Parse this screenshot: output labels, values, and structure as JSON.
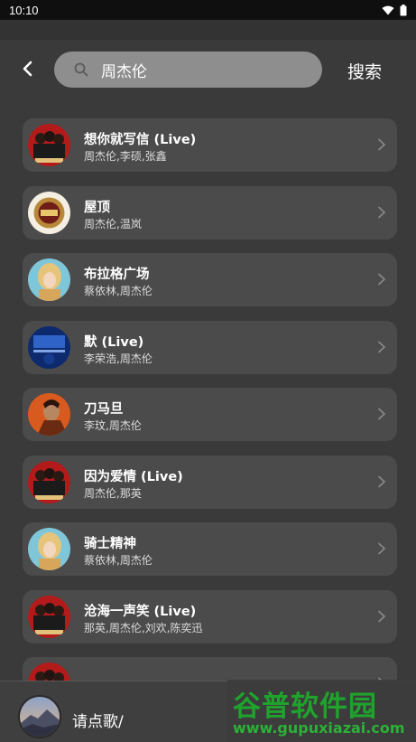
{
  "status_bar": {
    "time": "10:10"
  },
  "search": {
    "query": "周杰伦",
    "button_label": "搜索"
  },
  "songs": [
    {
      "title": "想你就写信 (Live)",
      "artists": "周杰伦,李硕,张鑫",
      "cover": "red-group"
    },
    {
      "title": "屋顶",
      "artists": "周杰伦,温岚",
      "cover": "gold-emblem"
    },
    {
      "title": "布拉格广场",
      "artists": "蔡依林,周杰伦",
      "cover": "blonde-portrait"
    },
    {
      "title": "默 (Live)",
      "artists": "李荣浩,周杰伦",
      "cover": "blue-stage"
    },
    {
      "title": "刀马旦",
      "artists": "李玟,周杰伦",
      "cover": "orange-portrait"
    },
    {
      "title": "因为爱情 (Live)",
      "artists": "周杰伦,那英",
      "cover": "red-group"
    },
    {
      "title": "骑士精神",
      "artists": "蔡依林,周杰伦",
      "cover": "blonde-portrait"
    },
    {
      "title": "沧海一声笑 (Live)",
      "artists": "那英,周杰伦,刘欢,陈奕迅",
      "cover": "red-group"
    },
    {
      "title": "",
      "artists": "",
      "cover": "red-group"
    }
  ],
  "player": {
    "label": "请点歌/"
  },
  "watermark": {
    "name": "谷普软件园",
    "url": "www.gupuxiazai.com"
  },
  "colors": {
    "background": "#3a3a3a",
    "card": "#4b4b4b",
    "search_field": "#8e8e8e",
    "watermark_green": "#1fa32c"
  }
}
